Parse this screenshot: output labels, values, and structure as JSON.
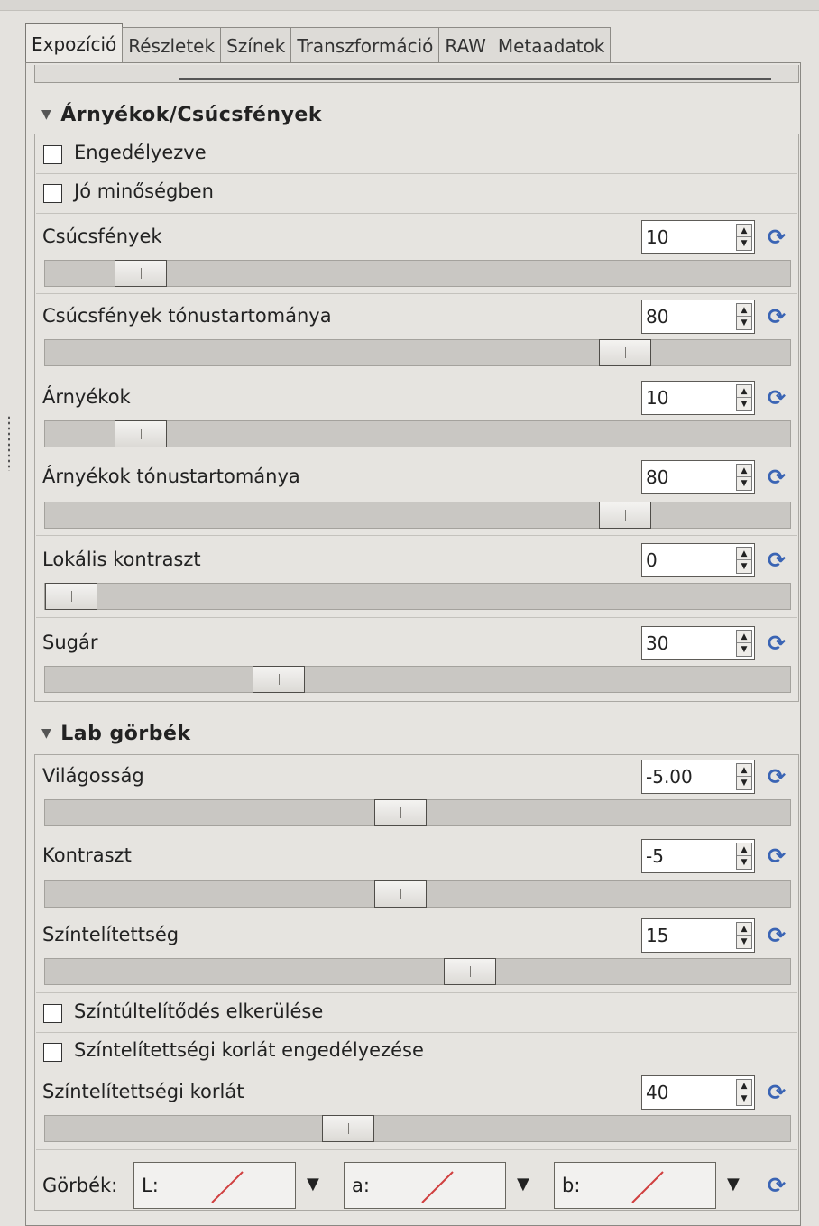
{
  "tabs": [
    "Expozíció",
    "Részletek",
    "Színek",
    "Transzformáció",
    "RAW",
    "Metaadatok"
  ],
  "active_tab": "Expozíció",
  "shadows_highlights": {
    "title": "Árnyékok/Csúcsfények",
    "enabled_label": "Engedélyezve",
    "enabled": false,
    "high_quality_label": "Jó minőségben",
    "high_quality": false,
    "highlights": {
      "label": "Csúcsfények",
      "value": "10",
      "level": 0.1
    },
    "highlights_tonal": {
      "label": "Csúcsfények tónustartománya",
      "value": "80",
      "level": 0.8
    },
    "shadows": {
      "label": "Árnyékok",
      "value": "10",
      "level": 0.1
    },
    "shadows_tonal": {
      "label": "Árnyékok tónustartománya",
      "value": "80",
      "level": 0.8
    },
    "local_contrast": {
      "label": "Lokális kontraszt",
      "value": "0",
      "level": 0.0
    },
    "radius": {
      "label": "Sugár",
      "value": "30",
      "level": 0.3
    }
  },
  "lab_curves": {
    "title": "Lab görbék",
    "brightness": {
      "label": "Világosság",
      "value": "-5.00",
      "level": 0.475
    },
    "contrast": {
      "label": "Kontraszt",
      "value": "-5",
      "level": 0.475
    },
    "saturation": {
      "label": "Színtelítettség",
      "value": "15",
      "level": 0.575
    },
    "avoid_clip_label": "Színtúltelítődés elkerülése",
    "avoid_clip": false,
    "enable_limit_label": "Színtelítettségi korlát engedélyezése",
    "enable_limit": false,
    "sat_limit": {
      "label": "Színtelítettségi korlát",
      "value": "40",
      "level": 0.4
    },
    "curves_label": "Görbék:",
    "curve_l": "L:",
    "curve_a": "a:",
    "curve_b": "b:"
  },
  "icons": {
    "reset": "reset-icon",
    "curve": "curve-icon",
    "dropdown": "dropdown-arrow-icon"
  },
  "colors": {
    "reset_icon": "#3a64b4",
    "curve_line": "#d04040"
  }
}
